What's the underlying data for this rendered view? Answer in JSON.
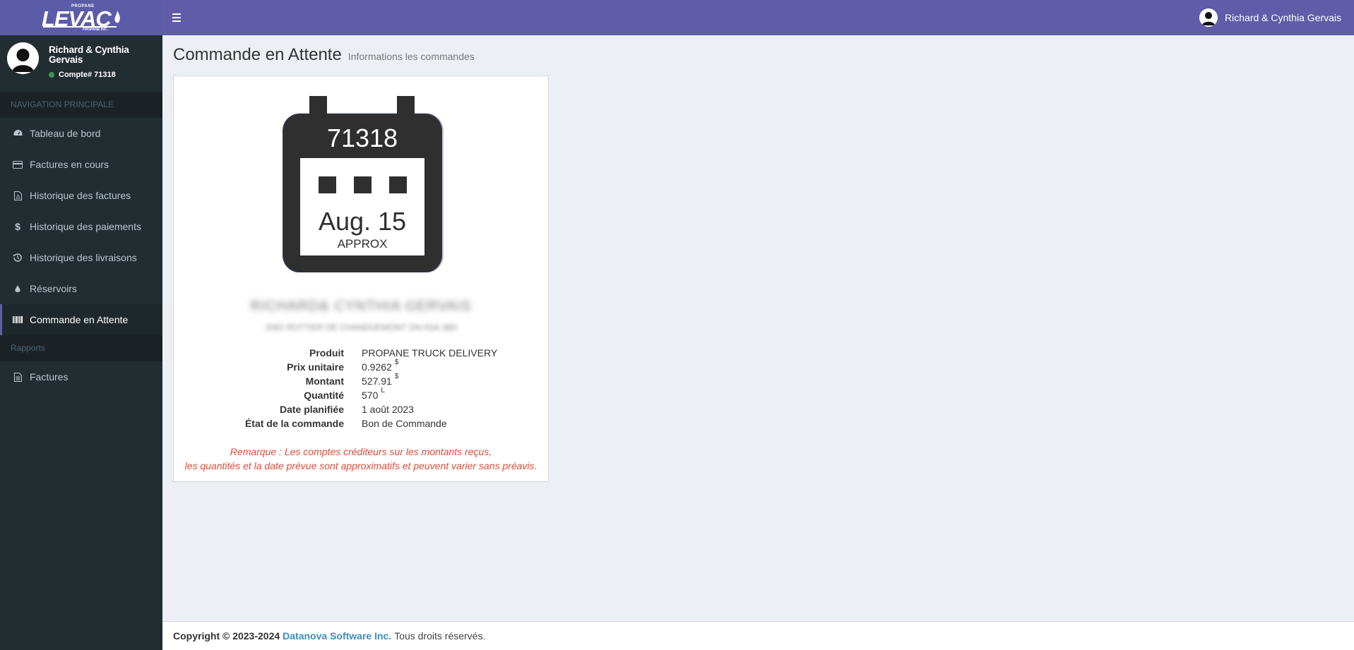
{
  "brand": {
    "logo_top": "PROPANE",
    "logo_main": "LEVAC",
    "logo_sub": "PROPANE INC."
  },
  "header": {
    "user_name": "Richard & Cynthia Gervais"
  },
  "sidebar": {
    "user_name": "Richard & Cynthia Gervais",
    "account": "Compte# 71318",
    "nav_header": "NAVIGATION PRINCIPALE",
    "items": [
      {
        "label": "Tableau de bord",
        "icon": "dashboard-icon"
      },
      {
        "label": "Factures en cours",
        "icon": "credit-card-icon"
      },
      {
        "label": "Historique des factures",
        "icon": "file-pdf-icon"
      },
      {
        "label": "Historique des paiements",
        "icon": "dollar-icon"
      },
      {
        "label": "Historique des livraisons",
        "icon": "history-icon"
      },
      {
        "label": "Réservoirs",
        "icon": "tint-icon"
      },
      {
        "label": "Commande en Attente",
        "icon": "barcode-icon"
      }
    ],
    "reports_header": "Rapports",
    "report_items": [
      {
        "label": "Factures",
        "icon": "file-text-icon"
      }
    ]
  },
  "page": {
    "title": "Commande en Attente",
    "subtitle": "Informations les commandes"
  },
  "calendar": {
    "number": "71318",
    "date": "Aug. 15",
    "note": "APPROX"
  },
  "customer": {
    "name_blurred": "RICHARD& CYNTHIA GERVAIS",
    "address_blurred": "2063 ROTTIER DE CHANDUEMONT ON K0A 3B0"
  },
  "details": [
    {
      "label": "Produit",
      "value": "PROPANE TRUCK DELIVERY",
      "unit": ""
    },
    {
      "label": "Prix unitaire",
      "value": "0.9262",
      "unit": "$"
    },
    {
      "label": "Montant",
      "value": "527.91",
      "unit": "$"
    },
    {
      "label": "Quantité",
      "value": "570",
      "unit": "L"
    },
    {
      "label": "Date planifiée",
      "value": "1 août 2023",
      "unit": ""
    },
    {
      "label": "État de la commande",
      "value": "Bon de Commande",
      "unit": ""
    }
  ],
  "remark": {
    "line1": "Remarque : Les comptes créditeurs sur les montants reçus,",
    "line2": "les quantités et la date prévue sont approximatifs et peuvent varier sans préavis."
  },
  "footer": {
    "copyright": "Copyright © 2023-2024",
    "company": "Datanova Software Inc.",
    "rights": "Tous droits réservés."
  },
  "colors": {
    "header": "#605ca8",
    "sidebar": "#222d32",
    "remark": "#dd4b39",
    "link": "#3c8dbc"
  }
}
